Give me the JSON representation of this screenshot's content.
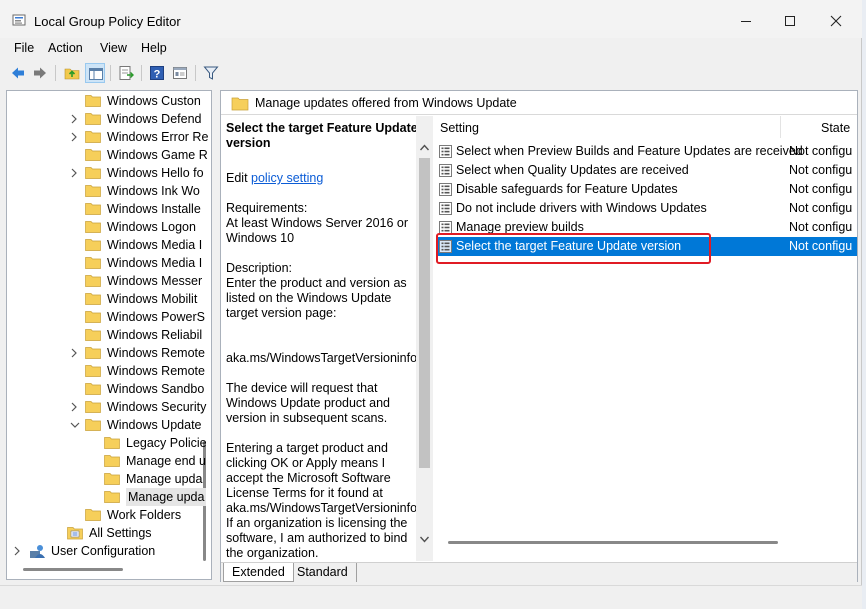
{
  "window": {
    "title": "Local Group Policy Editor"
  },
  "menu": [
    "File",
    "Action",
    "View",
    "Help"
  ],
  "toolbar": {
    "icons": [
      "back-arrow-icon",
      "forward-arrow-icon",
      "up-folder-icon",
      "show-hide-tree-icon",
      "export-list-icon",
      "help-icon",
      "properties-icon",
      "filter-icon"
    ]
  },
  "tree": {
    "items": [
      {
        "label": "Windows Custon",
        "indent": 1,
        "chevron": ""
      },
      {
        "label": "Windows Defend",
        "indent": 1,
        "chevron": "right"
      },
      {
        "label": "Windows Error Re",
        "indent": 1,
        "chevron": "right"
      },
      {
        "label": "Windows Game R",
        "indent": 1,
        "chevron": ""
      },
      {
        "label": "Windows Hello fo",
        "indent": 1,
        "chevron": "right"
      },
      {
        "label": "Windows Ink Wo",
        "indent": 1,
        "chevron": ""
      },
      {
        "label": "Windows Installe",
        "indent": 1,
        "chevron": ""
      },
      {
        "label": "Windows Logon",
        "indent": 1,
        "chevron": ""
      },
      {
        "label": "Windows Media I",
        "indent": 1,
        "chevron": ""
      },
      {
        "label": "Windows Media I",
        "indent": 1,
        "chevron": ""
      },
      {
        "label": "Windows Messer",
        "indent": 1,
        "chevron": ""
      },
      {
        "label": "Windows Mobilit",
        "indent": 1,
        "chevron": ""
      },
      {
        "label": "Windows PowerS",
        "indent": 1,
        "chevron": ""
      },
      {
        "label": "Windows Reliabil",
        "indent": 1,
        "chevron": ""
      },
      {
        "label": "Windows Remote",
        "indent": 1,
        "chevron": "right"
      },
      {
        "label": "Windows Remote",
        "indent": 1,
        "chevron": ""
      },
      {
        "label": "Windows Sandbo",
        "indent": 1,
        "chevron": ""
      },
      {
        "label": "Windows Security",
        "indent": 1,
        "chevron": "right"
      },
      {
        "label": "Windows Update",
        "indent": 1,
        "chevron": "down"
      },
      {
        "label": "Legacy Policie",
        "indent": 2,
        "chevron": ""
      },
      {
        "label": "Manage end u",
        "indent": 2,
        "chevron": ""
      },
      {
        "label": "Manage upda",
        "indent": 2,
        "chevron": ""
      },
      {
        "label": "Manage upda",
        "indent": 2,
        "chevron": "",
        "selected": true
      },
      {
        "label": "Work Folders",
        "indent": 1,
        "chevron": ""
      },
      {
        "label": "All Settings",
        "indent": 0.5,
        "chevron": "",
        "icon": "all-settings"
      },
      {
        "label": "User Configuration",
        "indent": -1,
        "chevron": "right",
        "icon": "user-config"
      }
    ]
  },
  "header": {
    "title": "Manage updates offered from Windows Update"
  },
  "extended": {
    "policy_title": "Select the target Feature Update version",
    "edit_prefix": "Edit",
    "edit_link": "policy setting",
    "requirements_label": "Requirements:",
    "requirements_text": "At least Windows Server 2016 or Windows 10",
    "description_label": "Description:",
    "description_1": "Enter the product and version as listed on the Windows Update target version page:",
    "description_url": "aka.ms/WindowsTargetVersioninfo",
    "description_2": "The device will request that Windows Update product and version in subsequent scans.",
    "description_3": "Entering a target product and clicking OK or Apply means I accept the Microsoft Software License Terms for it found at aka.ms/WindowsTargetVersioninfo. If an organization is licensing the software, I am authorized to bind the organization."
  },
  "list": {
    "columns": {
      "setting": "Setting",
      "state": "State"
    },
    "rows": [
      {
        "name": "Select when Preview Builds and Feature Updates are received",
        "state": "Not configu"
      },
      {
        "name": "Select when Quality Updates are received",
        "state": "Not configu"
      },
      {
        "name": "Disable safeguards for Feature Updates",
        "state": "Not configu"
      },
      {
        "name": "Do not include drivers with Windows Updates",
        "state": "Not configu"
      },
      {
        "name": "Manage preview builds",
        "state": "Not configu"
      },
      {
        "name": "Select the target Feature Update version",
        "state": "Not configu",
        "selected": true
      }
    ]
  },
  "tabs": {
    "extended": "Extended",
    "standard": "Standard"
  },
  "colors": {
    "selection": "#0078d7",
    "highlight_box": "#e01b24",
    "link": "#0b5cd6",
    "folder": "#f6cf5a"
  }
}
